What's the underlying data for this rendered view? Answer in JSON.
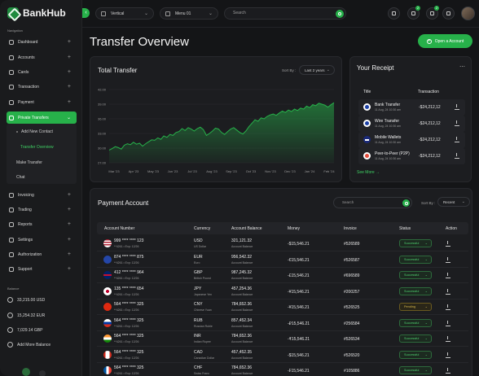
{
  "app": {
    "name": "BankHub"
  },
  "colors": {
    "accent": "#27b14a",
    "background": "#141517",
    "card": "#1c1d20",
    "pending": "#d8b84a"
  },
  "topbar": {
    "layout_dropdown": "Vertical",
    "menu_dropdown": "Menu 01",
    "search_placeholder": "Search",
    "notification_count_1": "2",
    "notification_count_2": "2"
  },
  "sidebar": {
    "nav_title": "Navigation",
    "items": [
      {
        "label": "Dashboard",
        "icon": "grid-icon"
      },
      {
        "label": "Accounts",
        "icon": "wallet-icon"
      },
      {
        "label": "Cards",
        "icon": "card-icon"
      },
      {
        "label": "Transaction",
        "icon": "transfer-icon"
      },
      {
        "label": "Payment",
        "icon": "payment-icon"
      },
      {
        "label": "Private Transfers",
        "icon": "transfer-icon"
      }
    ],
    "sub_items": [
      "Add New Contact",
      "Transfer Overview",
      "Make Transfer",
      "Chat"
    ],
    "items2": [
      {
        "label": "Invoicing",
        "icon": "invoice-icon"
      },
      {
        "label": "Trading",
        "icon": "trading-icon"
      },
      {
        "label": "Reports",
        "icon": "reports-icon"
      },
      {
        "label": "Settings",
        "icon": "gear-icon"
      },
      {
        "label": "Authorization",
        "icon": "lock-icon"
      },
      {
        "label": "Support",
        "icon": "support-icon"
      }
    ],
    "balance_title": "Balance",
    "balances": [
      "33,215.00 USD",
      "15,254.32 EUR",
      "7,029.14 GBP"
    ],
    "add_balance": "Add More Balance"
  },
  "page": {
    "title": "Transfer Overview",
    "open_account": "Open a Account"
  },
  "total_transfer": {
    "title": "Total Transfer",
    "sort_label": "Sort By :",
    "sort_value": "Last 2 years"
  },
  "chart_data": {
    "type": "area",
    "title": "Total Transfer",
    "xlabel": "",
    "ylabel": "",
    "x_ticks": [
      "Mar '23",
      "Apr '23",
      "May '23",
      "Jun '23",
      "Jul '23",
      "Aug '23",
      "Sep '23",
      "Oct '23",
      "Nov '23",
      "Dec '23",
      "Jan '24",
      "Feb '24"
    ],
    "y_ticks": [
      "42.00",
      "39.00",
      "36.00",
      "33.00",
      "30.00",
      "27.00"
    ],
    "ylim": [
      27,
      42
    ],
    "grid": true,
    "series": [
      {
        "color": "#27b14a",
        "values": [
          29.6,
          29.9,
          30.3,
          30.1,
          29.8,
          30.6,
          30.9,
          30.7,
          31.2,
          30.8,
          31.0,
          30.4,
          30.9,
          31.3,
          31.7,
          31.6,
          32.1,
          31.8,
          32.5,
          32.2,
          32.8,
          32.6,
          33.2,
          33.4,
          34.0,
          33.6,
          34.2,
          33.9,
          33.5,
          34.0,
          34.3,
          33.8,
          32.6,
          33.0,
          33.5,
          34.1,
          33.9,
          33.2,
          32.8,
          33.4,
          33.9,
          34.2,
          33.7,
          33.2,
          32.9,
          33.5,
          34.4,
          35.1,
          35.8,
          35.5,
          36.2,
          36.0,
          36.5,
          36.8,
          37.0,
          36.7,
          37.2,
          37.6,
          37.3,
          37.8,
          37.5,
          38.0,
          37.7,
          38.2,
          38.0,
          38.6,
          38.3,
          38.9,
          38.7,
          39.2,
          39.0,
          38.8,
          38.4,
          38.9,
          39.3
        ]
      }
    ]
  },
  "receipt": {
    "title": "Your Receipt",
    "col_title": "Title",
    "col_transaction": "Transaction",
    "rows": [
      {
        "name": "Bank Transfer",
        "date": "11 Aug, 24 10:30 am",
        "amount": "-$24,212,12",
        "icon": "paypal-icon"
      },
      {
        "name": "Wire Transfer",
        "date": "11 Aug, 24 10:30 am",
        "amount": "-$24,212,12",
        "icon": "paypal-icon"
      },
      {
        "name": "Mobile Wallets",
        "date": "11 Aug, 24 10:30 am",
        "amount": "-$24,212,12",
        "icon": "visa-icon"
      },
      {
        "name": "Peer-to-Peer (P2P)",
        "date": "11 Aug, 24 10:30 am",
        "amount": "-$24,212,12",
        "icon": "google-icon"
      }
    ],
    "see_more": "See More"
  },
  "payment_account": {
    "title": "Payment Account",
    "search_placeholder": "Search",
    "sort_label": "Sort By :",
    "sort_value": "Recent",
    "columns": [
      "Account Number",
      "Currency",
      "Account Balance",
      "Money",
      "Invoice",
      "Status",
      "Action"
    ],
    "rows": [
      {
        "account": "999 **** **** 123",
        "exp": "**4261 • Exp: 12/26",
        "currency": "USD",
        "currency_name": "US Dollar",
        "balance": "321,121.32",
        "balance_label": "Account Balance",
        "money": "-$15,546.21",
        "invoice": "#526589",
        "status": "Successful",
        "flag": "us"
      },
      {
        "account": "874 **** **** 875",
        "exp": "**4261 • Exp: 12/26",
        "currency": "EUR",
        "currency_name": "Euro",
        "balance": "956,542.32",
        "balance_label": "Account Balance",
        "money": "-€15,546.21",
        "invoice": "#526587",
        "status": "Successful",
        "flag": "eu"
      },
      {
        "account": "412 **** **** 964",
        "exp": "**4261 • Exp: 12/26",
        "currency": "GBP",
        "currency_name": "British Pound",
        "balance": "987,245.32",
        "balance_label": "Account Balance",
        "money": "-£15,546.21",
        "invoice": "#696589",
        "status": "Successful",
        "flag": "gb"
      },
      {
        "account": "135 **** **** 654",
        "exp": "**4261 • Exp: 12/26",
        "currency": "JPY",
        "currency_name": "Japanese Yen",
        "balance": "457,254.36",
        "balance_label": "Account Balance",
        "money": "-¥15,546.21",
        "invoice": "#200257",
        "status": "Successful",
        "flag": "jp"
      },
      {
        "account": "564 **** **** 325",
        "exp": "**4261 • Exp: 12/26",
        "currency": "CNY",
        "currency_name": "Chinese Yuan",
        "balance": "784,652.36",
        "balance_label": "Account Balance",
        "money": "-¥15,546.21",
        "invoice": "#526525",
        "status": "Pending",
        "flag": "cn"
      },
      {
        "account": "564 **** **** 325",
        "exp": "**4261 • Exp: 12/26",
        "currency": "RUB",
        "currency_name": "Russian Ruble",
        "balance": "857,452.34",
        "balance_label": "Account Balance",
        "money": "-₽15,546.21",
        "invoice": "#256584",
        "status": "Successful",
        "flag": "ru"
      },
      {
        "account": "564 **** **** 325",
        "exp": "**4261 • Exp: 12/26",
        "currency": "INR",
        "currency_name": "Indian Rupee",
        "balance": "784,652.36",
        "balance_label": "Account Balance",
        "money": "-₹15,546.21",
        "invoice": "#526534",
        "status": "Successful",
        "flag": "in"
      },
      {
        "account": "564 **** **** 325",
        "exp": "**4261 • Exp: 12/26",
        "currency": "CAD",
        "currency_name": "Canadian Dollar",
        "balance": "457,452.35",
        "balance_label": "Account Balance",
        "money": "-$15,546.21",
        "invoice": "#526520",
        "status": "Successful",
        "flag": "ca"
      },
      {
        "account": "564 **** **** 325",
        "exp": "**4261 • Exp: 12/26",
        "currency": "CHF",
        "currency_name": "Swiss Franc",
        "balance": "784,652.36",
        "balance_label": "Account Balance",
        "money": "-₣15,546.21",
        "invoice": "#105886",
        "status": "Successful",
        "flag": "fr"
      }
    ]
  }
}
